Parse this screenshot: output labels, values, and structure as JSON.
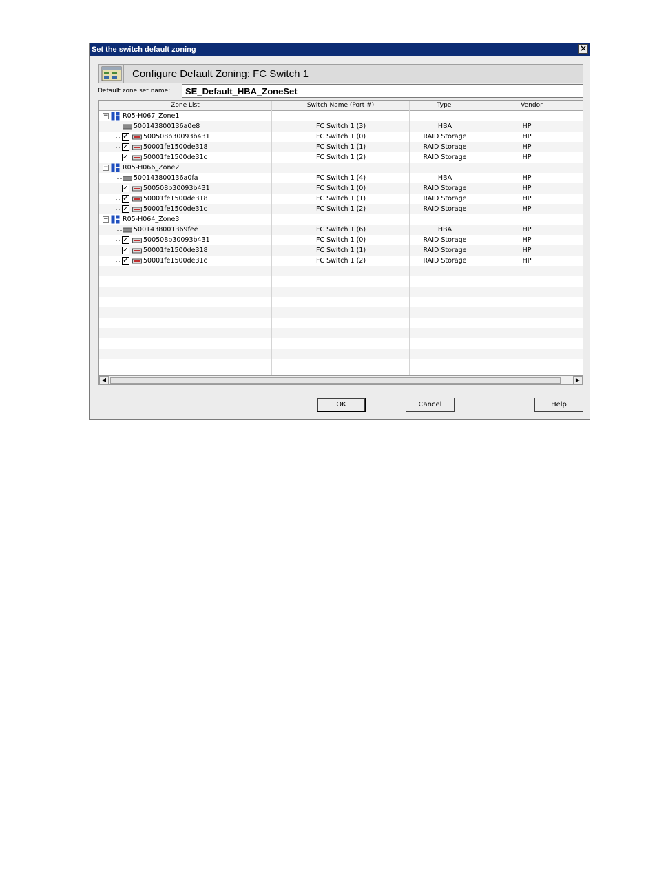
{
  "window": {
    "title": "Set the switch default zoning"
  },
  "header": {
    "title": "Configure Default Zoning: FC Switch 1"
  },
  "zone_set": {
    "label": "Default zone set name:",
    "value": "SE_Default_HBA_ZoneSet"
  },
  "columns": [
    "Zone List",
    "Switch Name (Port #)",
    "Type",
    "Vendor"
  ],
  "zones": [
    {
      "name": "R05-H067_Zone1",
      "members": [
        {
          "name": "500143800136a0e8",
          "switch": "FC Switch 1 (3)",
          "type": "HBA",
          "vendor": "HP",
          "kind": "hba"
        },
        {
          "name": "500508b30093b431",
          "switch": "FC Switch 1 (0)",
          "type": "RAID Storage",
          "vendor": "HP",
          "kind": "storage"
        },
        {
          "name": "50001fe1500de318",
          "switch": "FC Switch 1 (1)",
          "type": "RAID Storage",
          "vendor": "HP",
          "kind": "storage"
        },
        {
          "name": "50001fe1500de31c",
          "switch": "FC Switch 1 (2)",
          "type": "RAID Storage",
          "vendor": "HP",
          "kind": "storage"
        }
      ]
    },
    {
      "name": "R05-H066_Zone2",
      "members": [
        {
          "name": "500143800136a0fa",
          "switch": "FC Switch 1 (4)",
          "type": "HBA",
          "vendor": "HP",
          "kind": "hba"
        },
        {
          "name": "500508b30093b431",
          "switch": "FC Switch 1 (0)",
          "type": "RAID Storage",
          "vendor": "HP",
          "kind": "storage"
        },
        {
          "name": "50001fe1500de318",
          "switch": "FC Switch 1 (1)",
          "type": "RAID Storage",
          "vendor": "HP",
          "kind": "storage"
        },
        {
          "name": "50001fe1500de31c",
          "switch": "FC Switch 1 (2)",
          "type": "RAID Storage",
          "vendor": "HP",
          "kind": "storage"
        }
      ]
    },
    {
      "name": "R05-H064_Zone3",
      "members": [
        {
          "name": "5001438001369fee",
          "switch": "FC Switch 1 (6)",
          "type": "HBA",
          "vendor": "HP",
          "kind": "hba"
        },
        {
          "name": "500508b30093b431",
          "switch": "FC Switch 1 (0)",
          "type": "RAID Storage",
          "vendor": "HP",
          "kind": "storage"
        },
        {
          "name": "50001fe1500de318",
          "switch": "FC Switch 1 (1)",
          "type": "RAID Storage",
          "vendor": "HP",
          "kind": "storage"
        },
        {
          "name": "50001fe1500de31c",
          "switch": "FC Switch 1 (2)",
          "type": "RAID Storage",
          "vendor": "HP",
          "kind": "storage"
        }
      ]
    }
  ],
  "buttons": {
    "ok": "OK",
    "cancel": "Cancel",
    "help": "Help"
  },
  "colors": {
    "titlebar": "#0c2c74",
    "dialog_bg": "#ececec",
    "zone_icon": "#1f4fbf"
  }
}
